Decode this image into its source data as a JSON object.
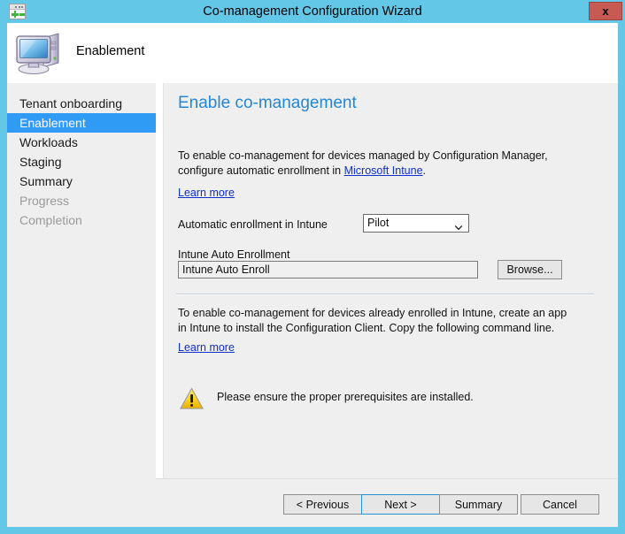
{
  "window": {
    "title": "Co-management Configuration Wizard",
    "app_icon": "wizard-window-icon",
    "close_label": "x",
    "titlebar_color": "#63c7e8",
    "close_color": "#c75b54"
  },
  "header": {
    "icon": "computer-icon",
    "title": "Enablement"
  },
  "sidebar": {
    "items": [
      {
        "label": "Tenant onboarding",
        "state": "normal"
      },
      {
        "label": "Enablement",
        "state": "selected"
      },
      {
        "label": "Workloads",
        "state": "normal"
      },
      {
        "label": "Staging",
        "state": "normal"
      },
      {
        "label": "Summary",
        "state": "normal"
      },
      {
        "label": "Progress",
        "state": "disabled"
      },
      {
        "label": "Completion",
        "state": "disabled"
      }
    ],
    "selected_color": "#2f9bf5"
  },
  "content": {
    "heading": "Enable co-management",
    "paragraph1": {
      "before_link": "To enable co-management for devices managed by Configuration Manager, configure automatic enrollment in ",
      "link": "Microsoft Intune",
      "after_link": "."
    },
    "learn_more_1": "Learn more",
    "enrollment_label": "Automatic enrollment in Intune",
    "enrollment_value": "Pilot",
    "enrollment_options": [
      "Pilot"
    ],
    "enrollment_chevron": "chevron-down-icon",
    "auto_enroll_label": "Intune Auto Enrollment",
    "auto_enroll_value": "Intune Auto Enroll",
    "auto_enroll_placeholder": "",
    "browse_label": "Browse...",
    "paragraph2": "To enable co-management for devices already enrolled in Intune, create an app in Intune to install the Configuration Client. Copy the following command line.",
    "learn_more_2": "Learn more",
    "warning_icon": "warning-triangle-icon",
    "warning_text": "Please ensure the proper prerequisites are installed.",
    "link_color": "#0f31c9",
    "heading_color": "#2387d8"
  },
  "footer": {
    "previous_label": "< Previous",
    "next_label": "Next >",
    "summary_label": "Summary",
    "cancel_label": "Cancel",
    "default_button": "Next >"
  }
}
